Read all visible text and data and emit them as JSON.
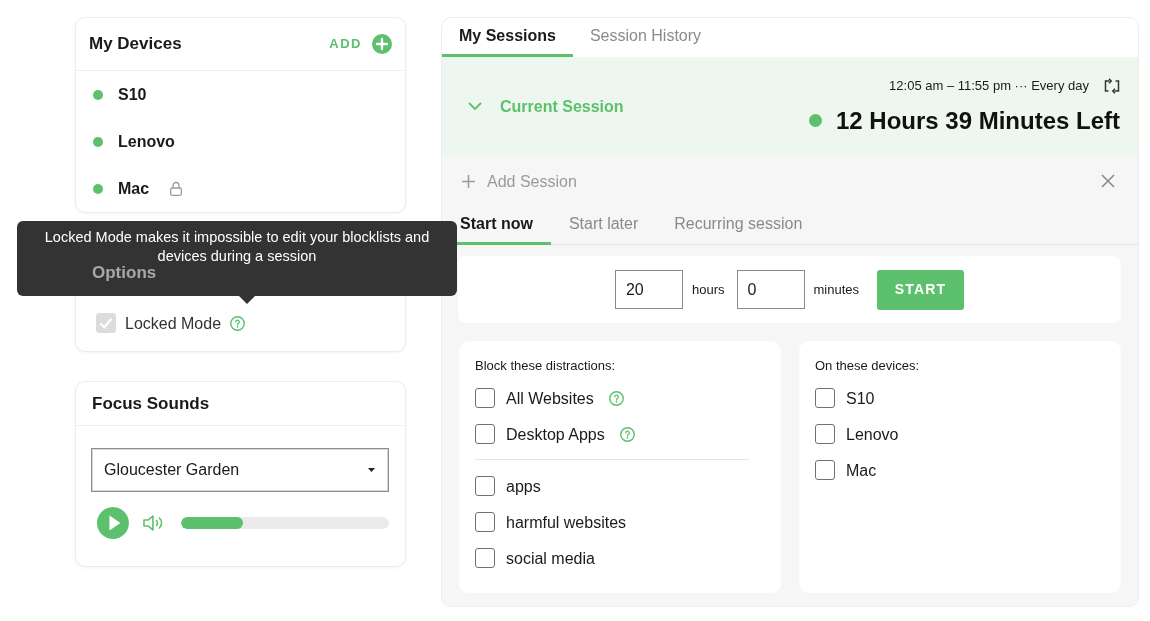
{
  "devices_card": {
    "title": "My Devices",
    "add_label": "ADD",
    "devices": [
      {
        "name": "S10",
        "online": true,
        "locked": false
      },
      {
        "name": "Lenovo",
        "online": true,
        "locked": false
      },
      {
        "name": "Mac",
        "online": true,
        "locked": true
      }
    ]
  },
  "options_card": {
    "title": "Options",
    "locked_mode": {
      "label": "Locked Mode",
      "checked": true,
      "disabled": true,
      "help": true
    }
  },
  "tooltip": {
    "text": "Locked Mode makes it impossible to edit your blocklists and devices during a session"
  },
  "focus_sounds": {
    "title": "Focus Sounds",
    "sound": "Gloucester Garden",
    "playing": false,
    "volume": {
      "level": 0.3
    }
  },
  "session_tabs": [
    {
      "label": "My Sessions",
      "selected": true
    },
    {
      "label": "Session History",
      "selected": false
    }
  ],
  "current_session": {
    "title": "Current Session",
    "expanded": true,
    "schedule": "12:05 am – 11:55 pm ··· Every day",
    "active": true,
    "time_left": "12 Hours 39 Minutes Left"
  },
  "add_session": {
    "label": "Add Session"
  },
  "start_tabs": [
    {
      "label": "Start now",
      "selected": true
    },
    {
      "label": "Start later",
      "selected": false
    },
    {
      "label": "Recurring session",
      "selected": false
    }
  ],
  "duration": {
    "hours": "20",
    "hours_label": "hours",
    "minutes": "0",
    "minutes_label": "minutes",
    "start_button": "START"
  },
  "distractions": {
    "heading": "Block these distractions:",
    "presets": [
      {
        "label": "All Websites",
        "checked": false,
        "help": true
      },
      {
        "label": "Desktop Apps",
        "checked": false,
        "help": true
      }
    ],
    "blocklists": [
      {
        "label": "apps",
        "checked": false
      },
      {
        "label": "harmful websites",
        "checked": false
      },
      {
        "label": "social media",
        "checked": false
      }
    ]
  },
  "target_devices": {
    "heading": "On these devices:",
    "items": [
      {
        "label": "S10",
        "checked": false
      },
      {
        "label": "Lenovo",
        "checked": false
      },
      {
        "label": "Mac",
        "checked": false
      }
    ]
  }
}
